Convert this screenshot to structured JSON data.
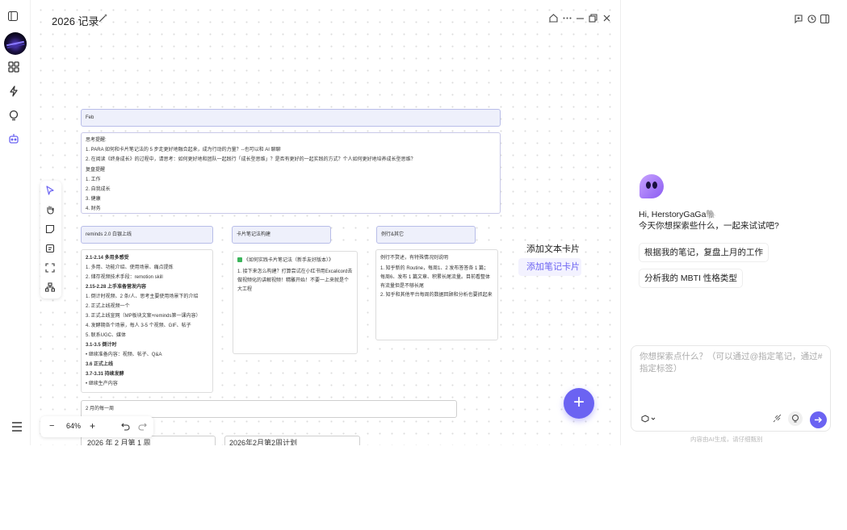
{
  "document": {
    "title": "2026 记录"
  },
  "cards": {
    "feb": "Feb",
    "thinking": [
      "思考提醒:",
      "1. PARA 如何和卡片笔记法的 5 步走更好地融合起来，成为行动的力量？--也可以和 AI 聊聊",
      "2. 在阅读《终身成长》的过程中，请思考：如何更好地和团队一起践行「成长型思维」？是否有更好的一起实践的方式？个人如何更好地培养成长型思维？",
      "复盘提醒",
      "1. 工作",
      "2. 自我成长",
      "3. 健康",
      "4. 财务"
    ],
    "reminds_head": "reminds 2.0 白银上线",
    "cardnote_head": "卡片笔记法构建",
    "routine_head": "例行&其它",
    "reminds_body": [
      {
        "t": "2.1-2.14 多用多感受",
        "b": true
      },
      {
        "t": "1. 多用、功能介绍、使用场景、痛点提炼"
      },
      {
        "t": "2. 储存视频技术手段：remotion skill"
      },
      {
        "t": "2.15-2.28 上手准备营发内容",
        "b": true
      },
      {
        "t": "1. 倒计时视频、2 条/人、思考主要使用场景下的介绍"
      },
      {
        "t": "2. 正式上线视频一个"
      },
      {
        "t": "3. 正式上线宣网（MP板块文案+reminds第一课内容）"
      },
      {
        "t": "4. 发酵期各个场景，每人 3-5 个视频、GIF、帖子"
      },
      {
        "t": "5. 联系UGC、媒体"
      },
      {
        "t": "3.1-3.5 倒计时",
        "b": true
      },
      {
        "t": "继续准备内容：视频、帖子、Q&A",
        "bullet": true
      },
      {
        "t": "3.6 正式上线",
        "b": true
      },
      {
        "t": "3.7-3.31 持续发酵",
        "b": true
      },
      {
        "t": "继续生产内容",
        "bullet": true
      }
    ],
    "cardnote_body": [
      "《如何实践卡片笔记法（新手友好版本）》",
      "1. 接下来怎么构建？打算尝试在小红书用Excalicord去做视频化的讲解视频！精雕开始！不要一上来就是个大工程"
    ],
    "routine_body": [
      "例行不赘述，有特殊情况则说明",
      "1. 知乎新的 Routine，每周1、2 发布答答各 1 篇；每周6、发布 1 篇文章、积累长尾流量。目前看整体有流量但是不够长尾",
      "2. 知乎和其他平台每周的数据回顾和分析也要抓起来"
    ],
    "weekly": "2 月的每一周",
    "week1": "2026 年 2 月第 1 周",
    "week2": "2026年2月第2周计划"
  },
  "context_menu": {
    "items": [
      "添加文本卡片",
      "添加笔记卡片"
    ],
    "highlight_color": "#6b63f2"
  },
  "zoom": {
    "level": "64%",
    "minus": "−",
    "plus": "+"
  },
  "fab": {
    "label": "+"
  },
  "assistant": {
    "greeting": "Hi, HerstoryGaGa🐘",
    "sub": "今天你想探索些什么，一起来试试吧?",
    "suggestions": [
      "根据我的笔记，复盘上月的工作",
      "分析我的 MBTI 性格类型"
    ],
    "placeholder": "你想探索点什么？（可以通过@指定笔记，通过#指定标签）",
    "footnote": "内容由AI生成，请仔细甄别"
  },
  "colors": {
    "accent": "#6b63f2",
    "card_head_bg": "#eef0fb"
  }
}
